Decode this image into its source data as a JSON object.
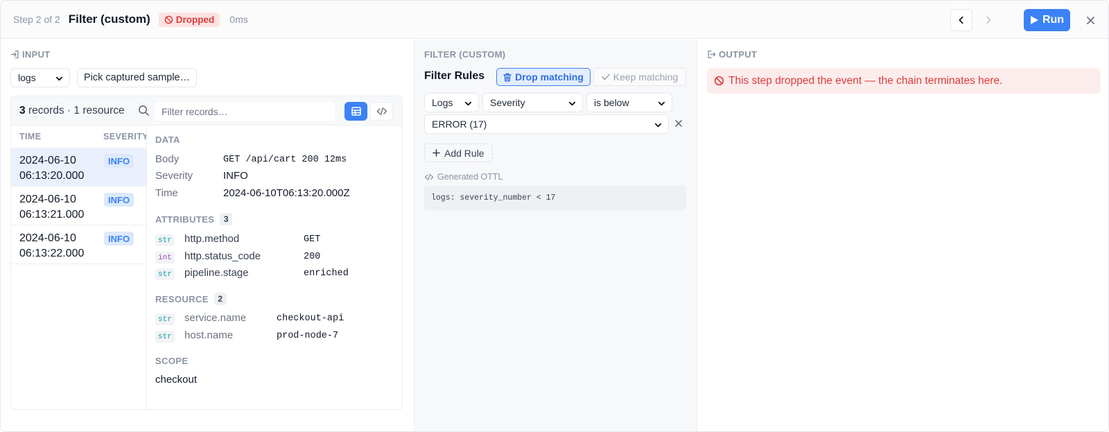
{
  "header": {
    "step": "Step 2 of 2",
    "title": "Filter (custom)",
    "status": "Dropped",
    "duration": "0ms",
    "run_label": "Run"
  },
  "input": {
    "section_label": "INPUT",
    "signal_select": "logs",
    "sample_button": "Pick captured sample…",
    "records_count": "3",
    "records_summary": "records · 1 resource",
    "filter_placeholder": "Filter records…",
    "columns": [
      "TIME",
      "SEVERITY"
    ],
    "records": [
      {
        "time_line1": "2024-06-10",
        "time_line2": "06:13:20.000",
        "severity": "INFO"
      },
      {
        "time_line1": "2024-06-10",
        "time_line2": "06:13:21.000",
        "severity": "INFO"
      },
      {
        "time_line1": "2024-06-10",
        "time_line2": "06:13:22.000",
        "severity": "INFO"
      }
    ],
    "details": {
      "data_label": "DATA",
      "data": [
        {
          "key": "Body",
          "value": "GET /api/cart 200 12ms"
        },
        {
          "key": "Severity",
          "value": "INFO"
        },
        {
          "key": "Time",
          "value": "2024-06-10T06:13:20.000Z"
        }
      ],
      "attributes_label": "ATTRIBUTES",
      "attributes_count": "3",
      "attributes": [
        {
          "type": "str",
          "key": "http.method",
          "value": "GET"
        },
        {
          "type": "int",
          "key": "http.status_code",
          "value": "200"
        },
        {
          "type": "str",
          "key": "pipeline.stage",
          "value": "enriched"
        }
      ],
      "resource_label": "RESOURCE",
      "resource_count": "2",
      "resource": [
        {
          "type": "str",
          "key": "service.name",
          "value": "checkout-api"
        },
        {
          "type": "str",
          "key": "host.name",
          "value": "prod-node-7"
        }
      ],
      "scope_label": "SCOPE",
      "scope": "checkout"
    }
  },
  "filter": {
    "section_label": "FILTER (CUSTOM)",
    "rules_title": "Filter Rules",
    "drop_label": "Drop matching",
    "keep_label": "Keep matching",
    "rule": {
      "signal": "Logs",
      "field": "Severity",
      "operator": "is below",
      "value": "ERROR (17)"
    },
    "add_rule_label": "Add Rule",
    "generated_label": "Generated OTTL",
    "generated_code": "logs: severity_number < 17"
  },
  "output": {
    "section_label": "OUTPUT",
    "message": "This step dropped the event — the chain terminates here."
  },
  "colors": {
    "accent": "#3b82f6",
    "danger": "#dc3c3c",
    "danger_bg": "#fdecec"
  }
}
